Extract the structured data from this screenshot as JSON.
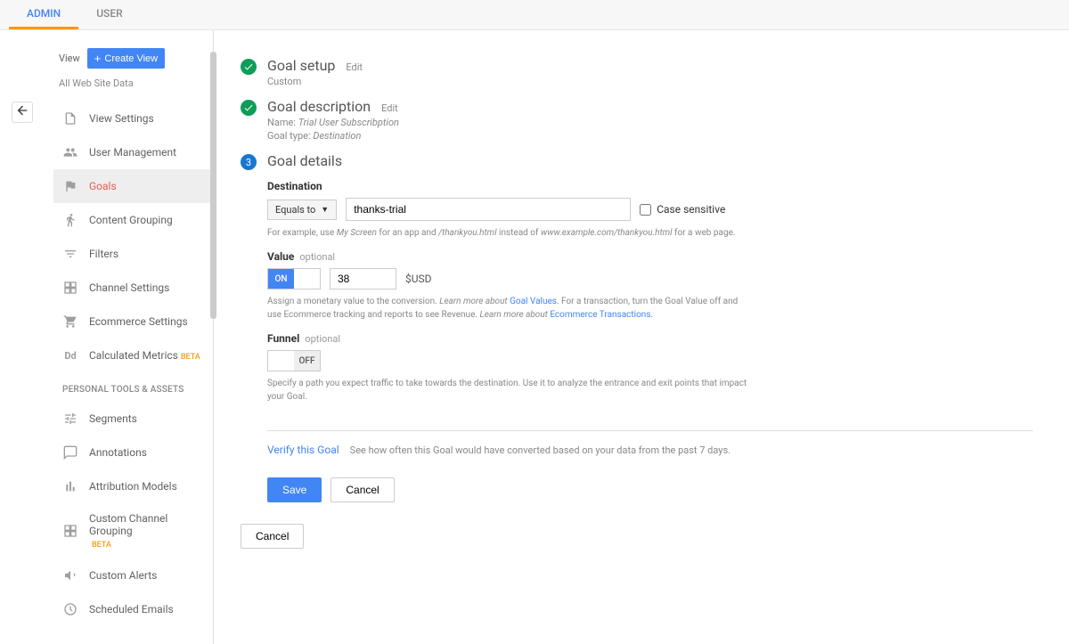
{
  "tabs": {
    "admin": "ADMIN",
    "user": "USER"
  },
  "sidebar": {
    "view_label": "View",
    "create_view": "Create View",
    "all_data": "All Web Site Data",
    "items": [
      {
        "label": "View Settings"
      },
      {
        "label": "User Management"
      },
      {
        "label": "Goals"
      },
      {
        "label": "Content Grouping"
      },
      {
        "label": "Filters"
      },
      {
        "label": "Channel Settings"
      },
      {
        "label": "Ecommerce Settings"
      },
      {
        "label": "Calculated Metrics",
        "beta": "BETA"
      }
    ],
    "section": "PERSONAL TOOLS & ASSETS",
    "items2": [
      {
        "label": "Segments"
      },
      {
        "label": "Annotations"
      },
      {
        "label": "Attribution Models"
      },
      {
        "label": "Custom Channel Grouping",
        "beta": "BETA"
      },
      {
        "label": "Custom Alerts"
      },
      {
        "label": "Scheduled Emails"
      }
    ]
  },
  "steps": {
    "setup": {
      "title": "Goal setup",
      "edit": "Edit",
      "sub": "Custom"
    },
    "desc": {
      "title": "Goal description",
      "edit": "Edit",
      "name_label": "Name:",
      "name_value": "Trial User Subscribption",
      "type_label": "Goal type:",
      "type_value": "Destination"
    },
    "details": {
      "title": "Goal details",
      "badge": "3"
    }
  },
  "destination": {
    "label": "Destination",
    "dropdown": "Equals to",
    "input": "thanks-trial",
    "case_label": "Case sensitive",
    "hint_pre": "For example, use ",
    "hint_i1": "My Screen",
    "hint_mid": " for an app and ",
    "hint_i2": "/thankyou.html",
    "hint_mid2": " instead of ",
    "hint_i3": "www.example.com/thankyou.html",
    "hint_end": " for a web page."
  },
  "value": {
    "label": "Value",
    "opt": "optional",
    "toggle_on": "ON",
    "input": "38",
    "unit": "$USD",
    "hint_pre": "Assign a monetary value to the conversion. ",
    "hint_link1a": "Learn more about ",
    "hint_link1b": "Goal Values",
    "hint_mid": ". For a transaction, turn the Goal Value off and use Ecommerce tracking and reports to see Revenue. ",
    "hint_link2a": "Learn more about ",
    "hint_link2b": "Ecommerce Transactions",
    "hint_end": "."
  },
  "funnel": {
    "label": "Funnel",
    "opt": "optional",
    "toggle_off": "OFF",
    "hint": "Specify a path you expect traffic to take towards the destination. Use it to analyze the entrance and exit points that impact your Goal."
  },
  "verify": {
    "link": "Verify this Goal",
    "text": "See how often this Goal would have converted based on your data from the past 7 days."
  },
  "buttons": {
    "save": "Save",
    "cancel": "Cancel",
    "outer_cancel": "Cancel"
  }
}
